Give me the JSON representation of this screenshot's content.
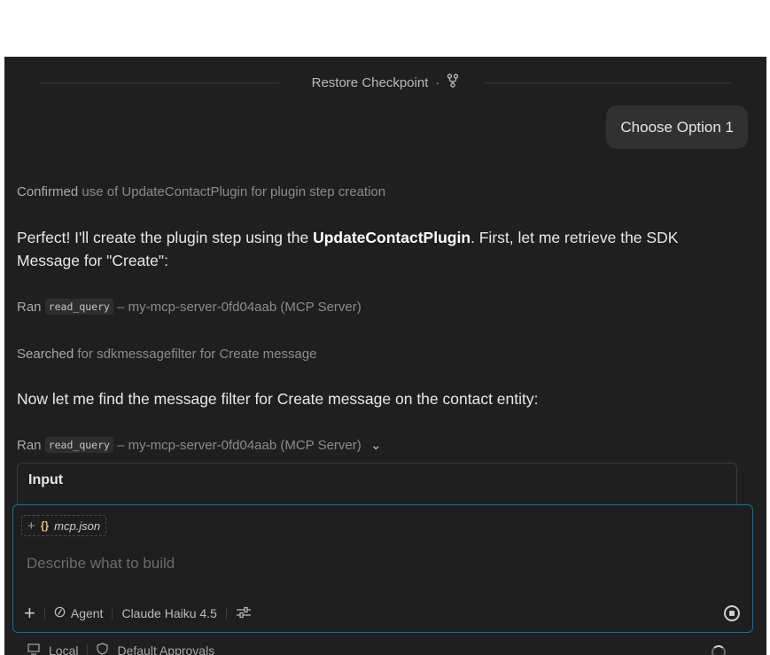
{
  "checkpoint": {
    "label": "Restore Checkpoint",
    "separator": "·",
    "icon": "git-branch-icon"
  },
  "user_message": "Choose Option 1",
  "steps": {
    "confirmed": {
      "verb": "Confirmed",
      "rest": "use of UpdateContactPlugin for plugin step creation"
    },
    "perfect": {
      "a": "Perfect! I'll create the plugin step using the ",
      "bold": "UpdateContactPlugin",
      "b": ". First, let me retrieve the SDK Message for \"Create\":"
    },
    "ran1": {
      "verb": "Ran",
      "tool": "read_query",
      "rest": "– my-mcp-server-0fd04aab (MCP Server)"
    },
    "searched": {
      "verb": "Searched",
      "rest": "for sdkmessagefilter for Create message"
    },
    "now": "Now let me find the message filter for Create message on the contact entity:",
    "ran2": {
      "verb": "Ran",
      "tool": "read_query",
      "rest": "– my-mcp-server-0fd04aab (MCP Server)",
      "chevron": "⌄"
    },
    "input_header": "Input"
  },
  "composer": {
    "chip_plus": "+",
    "chip_icon": "{}",
    "chip_file": "mcp.json",
    "placeholder": "Describe what to build",
    "add": "+",
    "mode": "Agent",
    "model": "Claude Haiku 4.5"
  },
  "status": {
    "local": "Local",
    "approvals": "Default Approvals"
  },
  "colors": {
    "panel": "#1f1f1f",
    "focus_border": "#1f6b8c",
    "bubble": "#313131"
  }
}
